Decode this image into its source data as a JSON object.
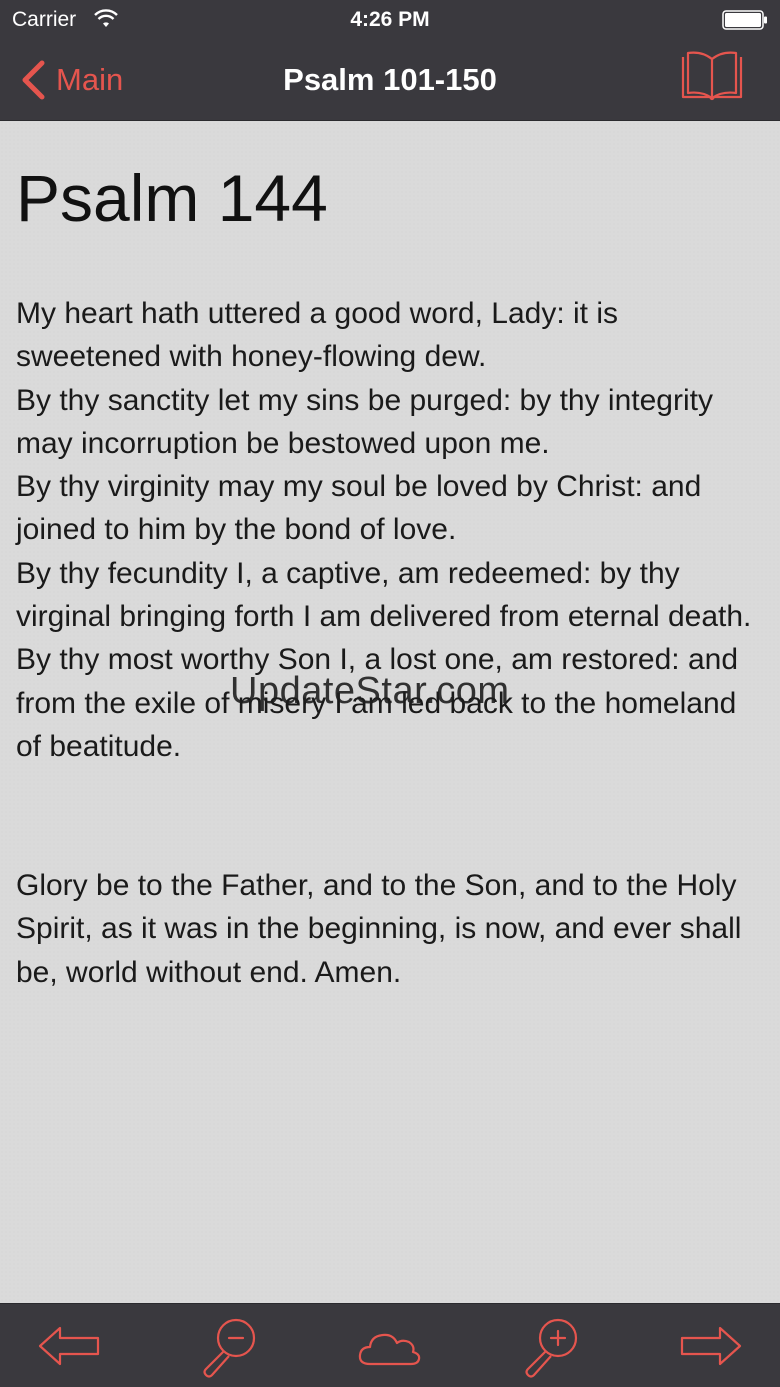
{
  "status_bar": {
    "carrier": "Carrier",
    "time": "4:26 PM"
  },
  "nav": {
    "back_label": "Main",
    "title": "Psalm 101-150"
  },
  "content": {
    "title": "Psalm 144",
    "verses": [
      "My heart hath uttered a good word, Lady: it is sweetened with honey-flowing dew.",
      "By thy sanctity let my sins be purged: by thy integrity may incorruption be bestowed upon me.",
      "By thy virginity may my soul be loved by Christ: and joined to him by the bond of love.",
      "By thy fecundity I, a captive, am redeemed: by thy virginal bringing forth I am delivered from eternal death.",
      "By thy most worthy Son I, a lost one, am restored: and from the exile of misery I am led back to the homeland of beatitude."
    ],
    "doxology": "Glory be to the Father, and to the Son, and to the Holy Spirit, as it was in the beginning, is now, and ever shall be, world without end. Amen.",
    "watermark": "UpdateStar.com"
  },
  "icons": {
    "wifi": "wifi-icon",
    "battery": "battery-icon",
    "back": "chevron-left-icon",
    "book": "book-icon",
    "prev": "arrow-left-icon",
    "zoom_out": "zoom-out-icon",
    "cloud": "cloud-icon",
    "zoom_in": "zoom-in-icon",
    "next": "arrow-right-icon"
  },
  "colors": {
    "accent": "#e5554e",
    "bar_bg": "#3a393e",
    "content_bg": "#dadada"
  }
}
